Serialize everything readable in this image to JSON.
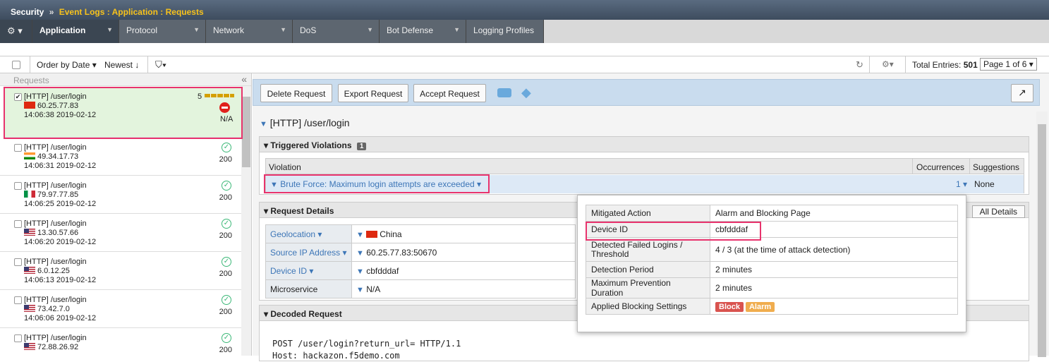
{
  "titlebar": {
    "root": "Security",
    "sep": "»",
    "crumb": "Event Logs : Application : Requests"
  },
  "tabs": [
    {
      "label": "Application",
      "active": true
    },
    {
      "label": "Protocol"
    },
    {
      "label": "Network"
    },
    {
      "label": "DoS"
    },
    {
      "label": "Bot Defense"
    },
    {
      "label": "Logging Profiles"
    }
  ],
  "toolbar": {
    "order": "Order by Date",
    "newest": "Newest",
    "total_label": "Total Entries:",
    "total": "501",
    "page": "Page 1 of 6"
  },
  "left": {
    "header": "Requests"
  },
  "requests": [
    {
      "path": "[HTTP] /user/login",
      "ip": "60.25.77.83",
      "time": "14:06:38 2019-02-12",
      "code": "N/A",
      "score": "5",
      "flag": "cn",
      "checked": true
    },
    {
      "path": "[HTTP] /user/login",
      "ip": "49.34.17.73",
      "time": "14:06:31 2019-02-12",
      "code": "200",
      "flag": "in"
    },
    {
      "path": "[HTTP] /user/login",
      "ip": "79.97.77.85",
      "time": "14:06:25 2019-02-12",
      "code": "200",
      "flag": "it"
    },
    {
      "path": "[HTTP] /user/login",
      "ip": "13.30.57.66",
      "time": "14:06:20 2019-02-12",
      "code": "200",
      "flag": "us"
    },
    {
      "path": "[HTTP] /user/login",
      "ip": "6.0.12.25",
      "time": "14:06:13 2019-02-12",
      "code": "200",
      "flag": "us"
    },
    {
      "path": "[HTTP] /user/login",
      "ip": "73.42.7.0",
      "time": "14:06:06 2019-02-12",
      "code": "200",
      "flag": "us"
    },
    {
      "path": "[HTTP] /user/login",
      "ip": "72.88.26.92",
      "time": "",
      "code": "200",
      "flag": "us"
    }
  ],
  "actions": {
    "delete": "Delete Request",
    "export": "Export Request",
    "accept": "Accept Request"
  },
  "detail": {
    "title": "[HTTP] /user/login",
    "violations_head": "Triggered Violations",
    "violations_count": "1",
    "col_violation": "Violation",
    "col_occurrences": "Occurrences",
    "col_suggestions": "Suggestions",
    "violation": "Brute Force: Maximum login attempts are exceeded",
    "occurrences": "1",
    "suggestion": "None",
    "request_head": "Request Details",
    "all_details": "All Details",
    "geo_label": "Geolocation",
    "geo_value": "China",
    "srcip_label": "Source IP Address",
    "srcip_value": "60.25.77.83:50670",
    "device_label": "Device ID",
    "device_value": "cbfdddaf",
    "micro_label": "Microservice",
    "micro_value": "N/A",
    "decoded_head": "Decoded Request",
    "decoded_line1": "POST /user/login?return_url= HTTP/1.1",
    "decoded_line2": "Host: hackazon.f5demo.com"
  },
  "popup": {
    "rows": [
      {
        "k": "Mitigated Action",
        "v": "Alarm and Blocking Page"
      },
      {
        "k": "Device ID",
        "v": "cbfdddaf"
      },
      {
        "k": "Detected Failed Logins / Threshold",
        "v": "4 / 3 (at the time of attack detection)"
      },
      {
        "k": "Detection Period",
        "v": "2 minutes"
      },
      {
        "k": "Maximum Prevention Duration",
        "v": "2 minutes"
      }
    ],
    "blocking_label": "Applied Blocking Settings",
    "block": "Block",
    "alarm": "Alarm"
  },
  "colors": {
    "highlight": "#e8336d",
    "accent": "#3d76b7",
    "block": "#d9534f",
    "alarm": "#f0ad4e"
  }
}
